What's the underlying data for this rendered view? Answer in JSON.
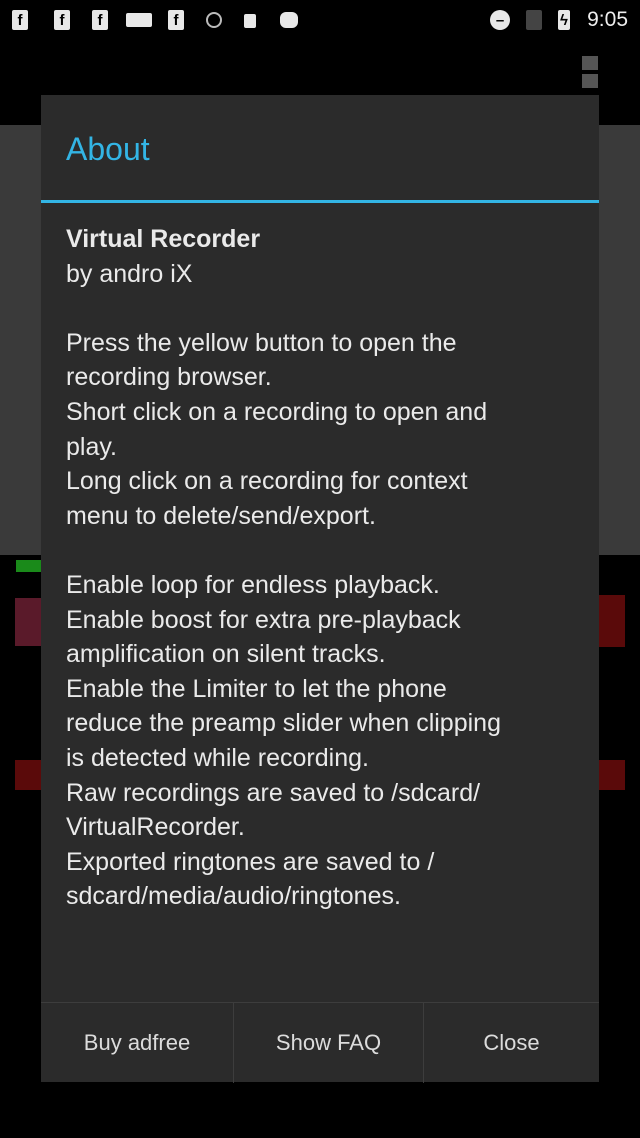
{
  "status_bar": {
    "icons": [
      "facebook-icon",
      "facebook-icon",
      "facebook-icon",
      "message-icon",
      "facebook-icon",
      "info-icon",
      "lock-icon",
      "android-icon",
      "do-not-disturb-icon",
      "no-signal-icon",
      "battery-charging-icon"
    ],
    "time": "9:05"
  },
  "dialog": {
    "title": "About",
    "app_name": "Virtual Recorder",
    "lines": [
      "by andro iX",
      "",
      "Press the yellow button to open the",
      "recording browser.",
      "Short click on a recording to open and",
      "play.",
      "Long click on a recording for context",
      "menu to delete/send/export.",
      "",
      "Enable loop for endless playback.",
      "Enable boost for extra pre-playback",
      "amplification on silent tracks.",
      "Enable the Limiter to let the phone",
      "reduce the preamp slider when clipping",
      "is detected while recording.",
      "Raw recordings are saved to /sdcard/",
      "VirtualRecorder.",
      "Exported ringtones are saved to /",
      "sdcard/media/audio/ringtones."
    ],
    "buttons": {
      "buy": "Buy adfree",
      "faq": "Show FAQ",
      "close": "Close"
    }
  },
  "colors": {
    "accent": "#33b5e5",
    "dialog_bg": "#2b2b2b"
  }
}
